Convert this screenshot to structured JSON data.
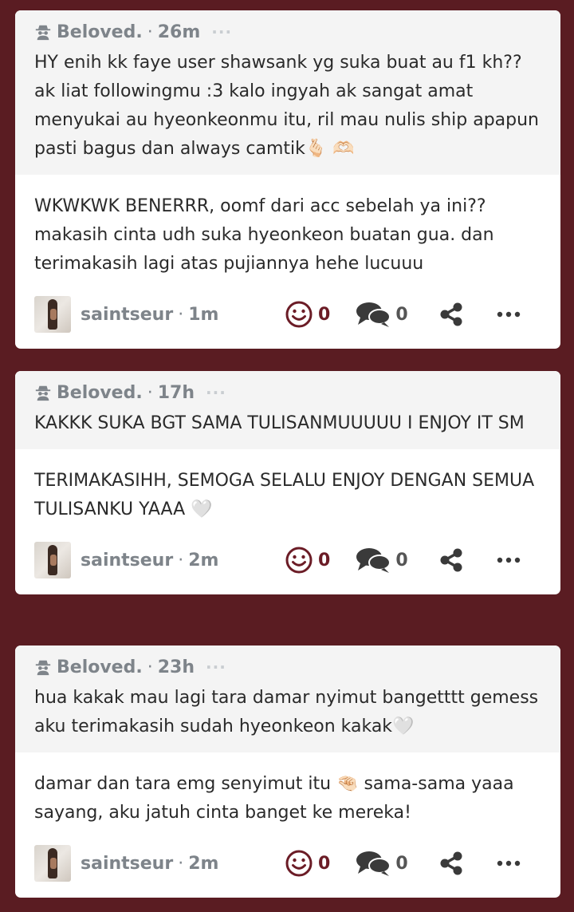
{
  "colors": {
    "background": "#5a1c22",
    "accent": "#6b1c26",
    "meta": "#7e848a"
  },
  "posts": [
    {
      "question": {
        "author": "Beloved.",
        "separator": "·",
        "time": "26m",
        "dots": "···",
        "text": "HY enih kk faye user shawsank yg suka buat au f1 kh?? ak liat followingmu :3 kalo ingyah ak sangat amat menyukai au hyeonkeonmu itu, ril mau nulis ship apapun pasti bagus dan always camtik🫰🏻 🫶🏻"
      },
      "answer": {
        "text": "WKWKWK BENERRR, oomf dari acc sebelah ya ini?? makasih cinta udh suka hyeonkeon buatan gua. dan terimakasih lagi atas pujiannya hehe lucuuu",
        "author": "saintseur",
        "separator": "·",
        "time": "1m",
        "likes": "0",
        "comments": "0"
      }
    },
    {
      "question": {
        "author": "Beloved.",
        "separator": "·",
        "time": "17h",
        "dots": "···",
        "text": "KAKKK SUKA BGT SAMA TULISANMUUUUU I ENJOY IT SM"
      },
      "answer": {
        "text": "TERIMAKASIHH, SEMOGA SELALU ENJOY DENGAN SEMUA TULISANKU YAAA 🤍",
        "author": "saintseur",
        "separator": "·",
        "time": "2m",
        "likes": "0",
        "comments": "0"
      }
    },
    {
      "question": {
        "author": "Beloved.",
        "separator": "·",
        "time": "23h",
        "dots": "···",
        "text": "hua kakak mau lagi tara damar nyimut bangetttt gemess aku terimakasih sudah hyeonkeon kakak🤍"
      },
      "answer": {
        "text": "damar dan tara emg senyimut itu 🤏🏻 sama-sama yaaa sayang, aku jatuh cinta banget ke mereka!",
        "author": "saintseur",
        "separator": "·",
        "time": "2m",
        "likes": "0",
        "comments": "0"
      }
    }
  ],
  "icons": {
    "anonymous": "anonymous-spy-icon",
    "like": "smile-icon",
    "comment": "comment-icon",
    "share": "share-icon",
    "more": "more-icon"
  }
}
